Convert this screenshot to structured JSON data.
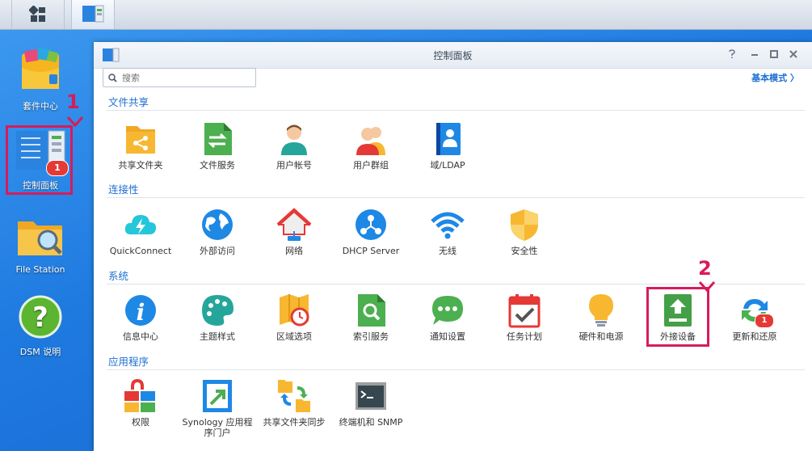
{
  "desktop": {
    "icons": [
      {
        "label": "套件中心"
      },
      {
        "label": "控制面板",
        "badge": "1"
      },
      {
        "label": "File Station"
      },
      {
        "label": "DSM 说明"
      }
    ]
  },
  "steps": {
    "one": "1",
    "two": "2"
  },
  "window": {
    "title": "控制面板",
    "search_placeholder": "搜索",
    "mode_link": "基本模式 〉",
    "sections": [
      {
        "title": "文件共享",
        "items": [
          "共享文件夹",
          "文件服务",
          "用户帐号",
          "用户群组",
          "域/LDAP"
        ]
      },
      {
        "title": "连接性",
        "items": [
          "QuickConnect",
          "外部访问",
          "网络",
          "DHCP Server",
          "无线",
          "安全性"
        ]
      },
      {
        "title": "系统",
        "items": [
          "信息中心",
          "主题样式",
          "区域选项",
          "索引服务",
          "通知设置",
          "任务计划",
          "硬件和电源",
          "外接设备",
          "更新和还原"
        ],
        "badge": "1"
      },
      {
        "title": "应用程序",
        "items": [
          "权限",
          "Synology 应用程序门户",
          "共享文件夹同步",
          "终端机和 SNMP"
        ]
      }
    ]
  },
  "colors": {
    "highlight": "#d81b5a",
    "accent": "#1d6fd1"
  }
}
